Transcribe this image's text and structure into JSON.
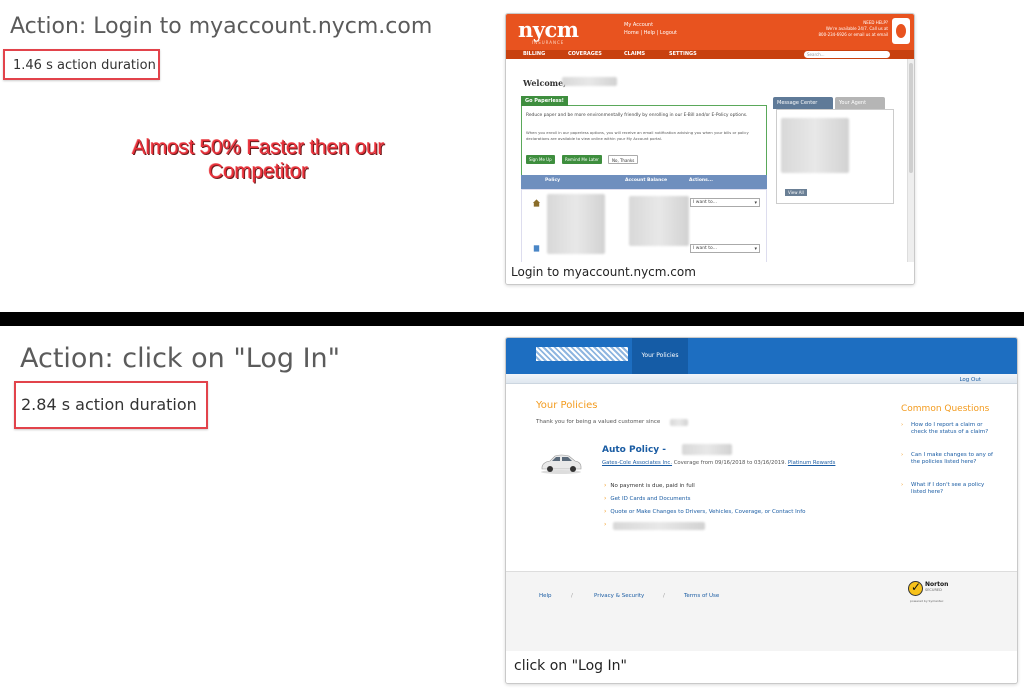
{
  "sections": [
    {
      "title": "Action: Login to myaccount.nycm.com",
      "duration": "1.46 s action duration",
      "caption": "Login to myaccount.nycm.com"
    },
    {
      "title": "Action: click on \"Log In\"",
      "duration": "2.84 s action duration",
      "caption": "click on \"Log In\""
    }
  ],
  "callout": {
    "line1": "Almost 50% Faster then our",
    "line2": "Competitor",
    "color": "#e8303a"
  },
  "nycm": {
    "logo": "nycm",
    "logo_sub": "INSURANCE",
    "account_links": [
      "My Account",
      "Home | Help | Logout"
    ],
    "help_lines": [
      "NEED HELP?",
      "We're available 24/7. Call us at",
      "800-234-6926 or email us at email"
    ],
    "nav": [
      "BILLING",
      "COVERAGES",
      "CLAIMS",
      "SETTINGS"
    ],
    "search_placeholder": "Search...",
    "welcome": "Welcome,",
    "paperless_tag": "Go Paperless!",
    "paperless_text": "Reduce paper and be more environmentally friendly by enrolling in our E-Bill and/or E-Policy options.",
    "paperless_text2": "When you enroll in our paperless options, you will receive an email notification advising you when your bills or policy declarations are available to view online within your My Account portal.",
    "buttons": [
      "Sign Me Up",
      "Remind Me Later",
      "No, Thanks"
    ],
    "tabs": [
      "Message Center",
      "Your Agent"
    ],
    "view_all": "View All",
    "table_headers": [
      "Policy",
      "Account Balance",
      "Actions..."
    ],
    "select_value": "I want to...",
    "accent": "#e8531f"
  },
  "policies": {
    "tab": "Your Policies",
    "logout": "Log Out",
    "title": "Your Policies",
    "thanks": "Thank you for being a valued customer since",
    "auto_policy": "Auto Policy -",
    "agency": "Gates-Cole Associates Inc.",
    "coverage": "Coverage from 09/16/2018 to 03/16/2019.",
    "rewards": "Platinum Rewards",
    "bullets": [
      "No payment is due, paid in full",
      "Get ID Cards and Documents",
      "Quote or Make Changes to Drivers, Vehicles, Coverage, or Contact Info"
    ],
    "common_questions": "Common Questions",
    "questions": [
      "How do I report a claim or check the status of a claim?",
      "Can I make changes to any of the policies listed here?",
      "What if I don't see a policy listed here?"
    ],
    "footer_links": [
      "Help",
      "Privacy & Security",
      "Terms of Use"
    ],
    "separator": "/",
    "norton": "Norton",
    "norton_sub": "SECURED",
    "norton_powered": "powered by Symantec",
    "accent": "#1d6ec1",
    "orange": "#f39b1e"
  }
}
